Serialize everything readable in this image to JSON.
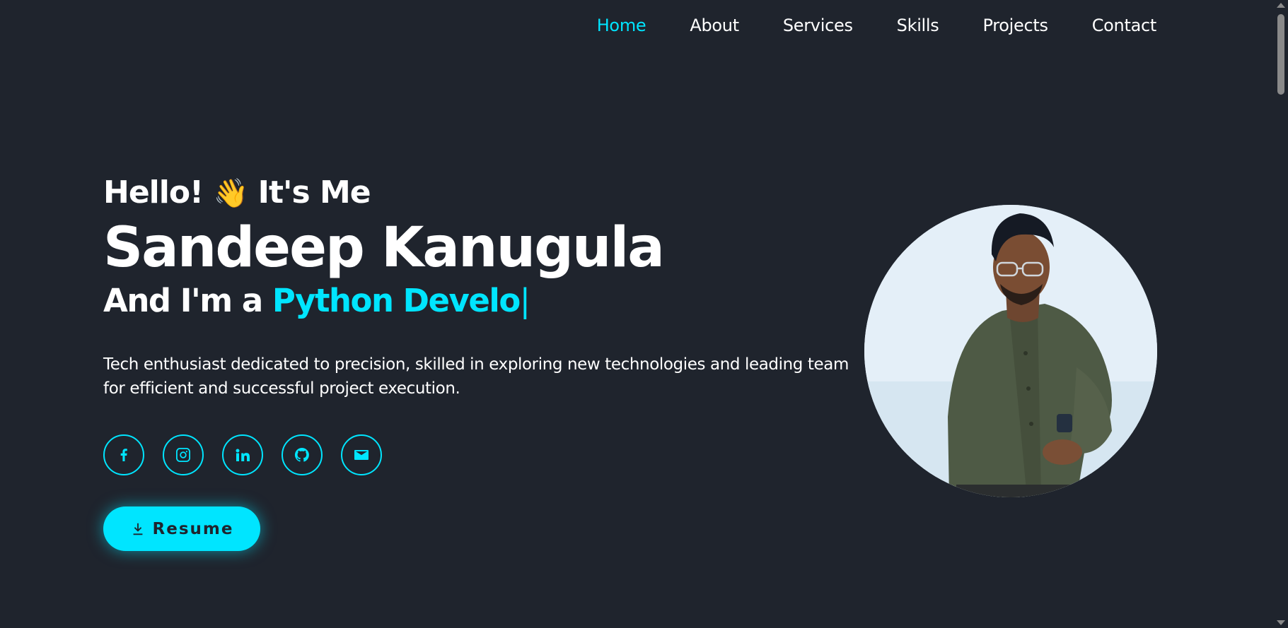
{
  "nav": {
    "items": [
      {
        "label": "Home",
        "active": true
      },
      {
        "label": "About"
      },
      {
        "label": "Services"
      },
      {
        "label": "Skills"
      },
      {
        "label": "Projects"
      },
      {
        "label": "Contact"
      }
    ]
  },
  "hero": {
    "greeting_prefix": "Hello!",
    "greeting_emoji": "👋",
    "greeting_suffix": "It's Me",
    "name": "Sandeep Kanugula",
    "role_prefix": "And I'm a",
    "role_typed": "Python Develo",
    "cursor": "|",
    "description": "Tech enthusiast dedicated to precision, skilled in exploring new technologies and leading team for efficient and successful project execution.",
    "resume_label": "Resume"
  },
  "socials": [
    {
      "icon": "facebook-icon"
    },
    {
      "icon": "instagram-icon"
    },
    {
      "icon": "linkedin-icon"
    },
    {
      "icon": "github-icon"
    },
    {
      "icon": "email-icon"
    }
  ],
  "colors": {
    "background": "#1f242d",
    "accent": "#00e5ff",
    "text": "#ffffff"
  }
}
